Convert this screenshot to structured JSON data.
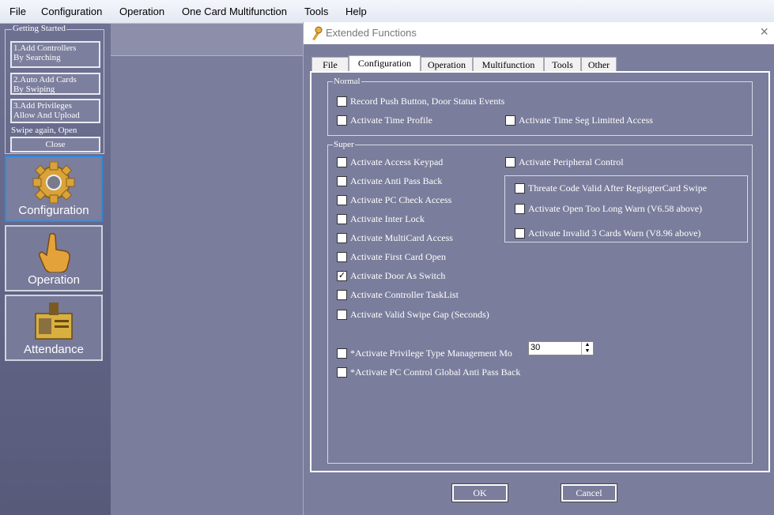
{
  "menubar": [
    "File",
    "Configuration",
    "Operation",
    "One Card Multifunction",
    "Tools",
    "Help"
  ],
  "sidebar": {
    "getting_started": "Getting Started",
    "btn1": "1.Add Controllers\nBy Searching",
    "btn2": "2.Auto Add Cards\nBy Swiping",
    "btn3": "3.Add Privileges\nAllow And Upload",
    "swipe": "Swipe again, Open",
    "close": "Close",
    "config": "Configuration",
    "operation": "Operation",
    "attendance": "Attendance"
  },
  "dialog": {
    "title": "Extended Functions",
    "tabs": [
      "File",
      "Configuration",
      "Operation",
      "Multifunction",
      "Tools",
      "Other"
    ],
    "normal_label": "Normal",
    "super_label": "Super",
    "normal": [
      "Record Push Button, Door Status Events",
      "Activate Time Profile",
      "Activate Time Seg Limitted Access"
    ],
    "super_left": [
      "Activate Access Keypad",
      "Activate Anti Pass Back",
      "Activate PC Check Access",
      "Activate Inter Lock",
      "Activate MultiCard Access",
      "Activate First Card Open",
      "Activate Door As Switch",
      "Activate Controller TaskList",
      "Activate Valid Swipe Gap (Seconds)"
    ],
    "peripheral": "Activate Peripheral Control",
    "super_right": [
      "Threate Code Valid After RegisgterCard Swipe",
      "Activate Open Too Long Warn (V6.58 above)",
      "Activate Invalid 3 Cards  Warn (V8.96 above)"
    ],
    "privilege": "*Activate Privilege Type Management Mo",
    "pc_global": "*Activate PC Control Global Anti Pass Back",
    "spin_value": "30",
    "ok": "OK",
    "cancel": "Cancel",
    "checked": "Activate Door As Switch"
  }
}
